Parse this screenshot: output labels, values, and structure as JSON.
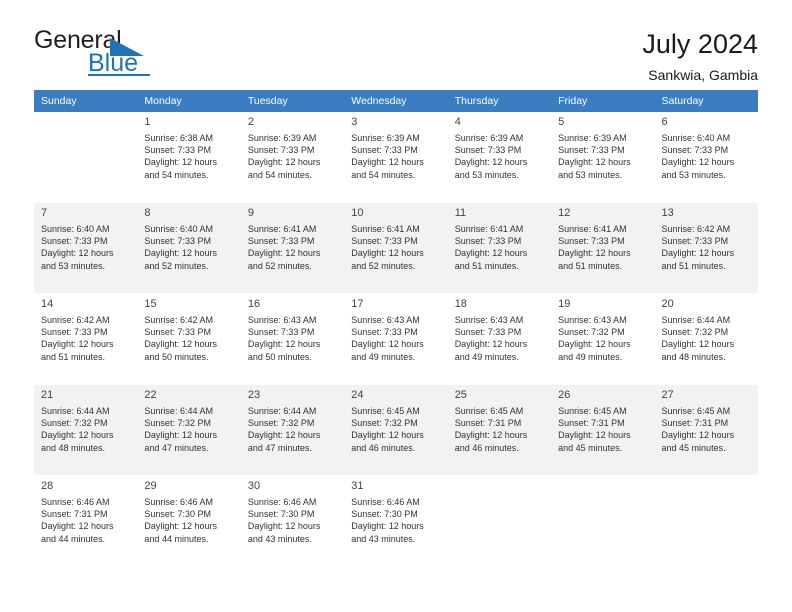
{
  "brand": {
    "name_part1": "General",
    "name_part2": "Blue"
  },
  "header": {
    "title": "July 2024",
    "subtitle": "Sankwia, Gambia"
  },
  "colors": {
    "header_blue": "#3a7dc0",
    "brand_blue": "#2272b8",
    "row_shade": "#f2f2f2"
  },
  "weekdays": [
    "Sunday",
    "Monday",
    "Tuesday",
    "Wednesday",
    "Thursday",
    "Friday",
    "Saturday"
  ],
  "weeks": [
    {
      "shaded": false,
      "days": [
        {
          "num": "",
          "sunrise": "",
          "sunset": "",
          "daylight1": "",
          "daylight2": ""
        },
        {
          "num": "1",
          "sunrise": "Sunrise: 6:38 AM",
          "sunset": "Sunset: 7:33 PM",
          "daylight1": "Daylight: 12 hours",
          "daylight2": "and 54 minutes."
        },
        {
          "num": "2",
          "sunrise": "Sunrise: 6:39 AM",
          "sunset": "Sunset: 7:33 PM",
          "daylight1": "Daylight: 12 hours",
          "daylight2": "and 54 minutes."
        },
        {
          "num": "3",
          "sunrise": "Sunrise: 6:39 AM",
          "sunset": "Sunset: 7:33 PM",
          "daylight1": "Daylight: 12 hours",
          "daylight2": "and 54 minutes."
        },
        {
          "num": "4",
          "sunrise": "Sunrise: 6:39 AM",
          "sunset": "Sunset: 7:33 PM",
          "daylight1": "Daylight: 12 hours",
          "daylight2": "and 53 minutes."
        },
        {
          "num": "5",
          "sunrise": "Sunrise: 6:39 AM",
          "sunset": "Sunset: 7:33 PM",
          "daylight1": "Daylight: 12 hours",
          "daylight2": "and 53 minutes."
        },
        {
          "num": "6",
          "sunrise": "Sunrise: 6:40 AM",
          "sunset": "Sunset: 7:33 PM",
          "daylight1": "Daylight: 12 hours",
          "daylight2": "and 53 minutes."
        }
      ]
    },
    {
      "shaded": true,
      "days": [
        {
          "num": "7",
          "sunrise": "Sunrise: 6:40 AM",
          "sunset": "Sunset: 7:33 PM",
          "daylight1": "Daylight: 12 hours",
          "daylight2": "and 53 minutes."
        },
        {
          "num": "8",
          "sunrise": "Sunrise: 6:40 AM",
          "sunset": "Sunset: 7:33 PM",
          "daylight1": "Daylight: 12 hours",
          "daylight2": "and 52 minutes."
        },
        {
          "num": "9",
          "sunrise": "Sunrise: 6:41 AM",
          "sunset": "Sunset: 7:33 PM",
          "daylight1": "Daylight: 12 hours",
          "daylight2": "and 52 minutes."
        },
        {
          "num": "10",
          "sunrise": "Sunrise: 6:41 AM",
          "sunset": "Sunset: 7:33 PM",
          "daylight1": "Daylight: 12 hours",
          "daylight2": "and 52 minutes."
        },
        {
          "num": "11",
          "sunrise": "Sunrise: 6:41 AM",
          "sunset": "Sunset: 7:33 PM",
          "daylight1": "Daylight: 12 hours",
          "daylight2": "and 51 minutes."
        },
        {
          "num": "12",
          "sunrise": "Sunrise: 6:41 AM",
          "sunset": "Sunset: 7:33 PM",
          "daylight1": "Daylight: 12 hours",
          "daylight2": "and 51 minutes."
        },
        {
          "num": "13",
          "sunrise": "Sunrise: 6:42 AM",
          "sunset": "Sunset: 7:33 PM",
          "daylight1": "Daylight: 12 hours",
          "daylight2": "and 51 minutes."
        }
      ]
    },
    {
      "shaded": false,
      "days": [
        {
          "num": "14",
          "sunrise": "Sunrise: 6:42 AM",
          "sunset": "Sunset: 7:33 PM",
          "daylight1": "Daylight: 12 hours",
          "daylight2": "and 51 minutes."
        },
        {
          "num": "15",
          "sunrise": "Sunrise: 6:42 AM",
          "sunset": "Sunset: 7:33 PM",
          "daylight1": "Daylight: 12 hours",
          "daylight2": "and 50 minutes."
        },
        {
          "num": "16",
          "sunrise": "Sunrise: 6:43 AM",
          "sunset": "Sunset: 7:33 PM",
          "daylight1": "Daylight: 12 hours",
          "daylight2": "and 50 minutes."
        },
        {
          "num": "17",
          "sunrise": "Sunrise: 6:43 AM",
          "sunset": "Sunset: 7:33 PM",
          "daylight1": "Daylight: 12 hours",
          "daylight2": "and 49 minutes."
        },
        {
          "num": "18",
          "sunrise": "Sunrise: 6:43 AM",
          "sunset": "Sunset: 7:33 PM",
          "daylight1": "Daylight: 12 hours",
          "daylight2": "and 49 minutes."
        },
        {
          "num": "19",
          "sunrise": "Sunrise: 6:43 AM",
          "sunset": "Sunset: 7:32 PM",
          "daylight1": "Daylight: 12 hours",
          "daylight2": "and 49 minutes."
        },
        {
          "num": "20",
          "sunrise": "Sunrise: 6:44 AM",
          "sunset": "Sunset: 7:32 PM",
          "daylight1": "Daylight: 12 hours",
          "daylight2": "and 48 minutes."
        }
      ]
    },
    {
      "shaded": true,
      "days": [
        {
          "num": "21",
          "sunrise": "Sunrise: 6:44 AM",
          "sunset": "Sunset: 7:32 PM",
          "daylight1": "Daylight: 12 hours",
          "daylight2": "and 48 minutes."
        },
        {
          "num": "22",
          "sunrise": "Sunrise: 6:44 AM",
          "sunset": "Sunset: 7:32 PM",
          "daylight1": "Daylight: 12 hours",
          "daylight2": "and 47 minutes."
        },
        {
          "num": "23",
          "sunrise": "Sunrise: 6:44 AM",
          "sunset": "Sunset: 7:32 PM",
          "daylight1": "Daylight: 12 hours",
          "daylight2": "and 47 minutes."
        },
        {
          "num": "24",
          "sunrise": "Sunrise: 6:45 AM",
          "sunset": "Sunset: 7:32 PM",
          "daylight1": "Daylight: 12 hours",
          "daylight2": "and 46 minutes."
        },
        {
          "num": "25",
          "sunrise": "Sunrise: 6:45 AM",
          "sunset": "Sunset: 7:31 PM",
          "daylight1": "Daylight: 12 hours",
          "daylight2": "and 46 minutes."
        },
        {
          "num": "26",
          "sunrise": "Sunrise: 6:45 AM",
          "sunset": "Sunset: 7:31 PM",
          "daylight1": "Daylight: 12 hours",
          "daylight2": "and 45 minutes."
        },
        {
          "num": "27",
          "sunrise": "Sunrise: 6:45 AM",
          "sunset": "Sunset: 7:31 PM",
          "daylight1": "Daylight: 12 hours",
          "daylight2": "and 45 minutes."
        }
      ]
    },
    {
      "shaded": false,
      "days": [
        {
          "num": "28",
          "sunrise": "Sunrise: 6:46 AM",
          "sunset": "Sunset: 7:31 PM",
          "daylight1": "Daylight: 12 hours",
          "daylight2": "and 44 minutes."
        },
        {
          "num": "29",
          "sunrise": "Sunrise: 6:46 AM",
          "sunset": "Sunset: 7:30 PM",
          "daylight1": "Daylight: 12 hours",
          "daylight2": "and 44 minutes."
        },
        {
          "num": "30",
          "sunrise": "Sunrise: 6:46 AM",
          "sunset": "Sunset: 7:30 PM",
          "daylight1": "Daylight: 12 hours",
          "daylight2": "and 43 minutes."
        },
        {
          "num": "31",
          "sunrise": "Sunrise: 6:46 AM",
          "sunset": "Sunset: 7:30 PM",
          "daylight1": "Daylight: 12 hours",
          "daylight2": "and 43 minutes."
        },
        {
          "num": "",
          "sunrise": "",
          "sunset": "",
          "daylight1": "",
          "daylight2": ""
        },
        {
          "num": "",
          "sunrise": "",
          "sunset": "",
          "daylight1": "",
          "daylight2": ""
        },
        {
          "num": "",
          "sunrise": "",
          "sunset": "",
          "daylight1": "",
          "daylight2": ""
        }
      ]
    }
  ]
}
